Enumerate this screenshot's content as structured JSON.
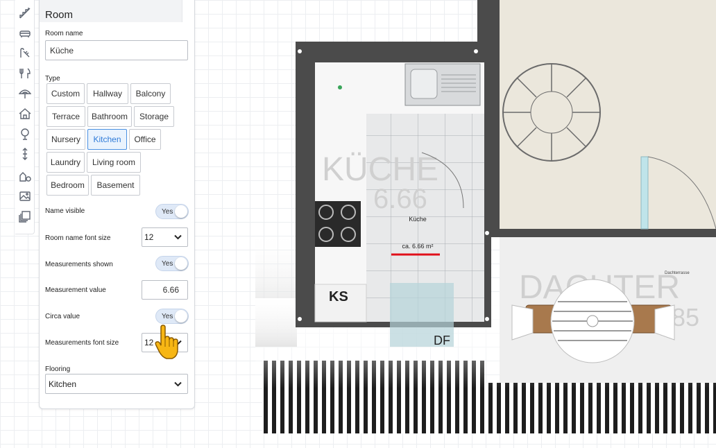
{
  "panel": {
    "title": "Room",
    "room_name_label": "Room name",
    "room_name_value": "Küche",
    "type_label": "Type",
    "types": [
      "Custom",
      "Hallway",
      "Balcony",
      "Terrace",
      "Bathroom",
      "Storage",
      "Nursery",
      "Kitchen",
      "Office",
      "Laundry",
      "Living room",
      "Bedroom",
      "Basement"
    ],
    "selected_type": "Kitchen",
    "name_visible_label": "Name visible",
    "name_visible_value": "Yes",
    "name_font_size_label": "Room name font size",
    "name_font_size_value": "12",
    "measurements_shown_label": "Measurements shown",
    "measurements_shown_value": "Yes",
    "measurement_value_label": "Measurement value",
    "measurement_value": "6.66",
    "circa_label": "Circa value",
    "circa_value": "Yes",
    "meas_font_size_label": "Measurements font size",
    "meas_font_size_value": "12",
    "flooring_label": "Flooring",
    "flooring_value": "Kitchen"
  },
  "toolbar": {
    "icons": [
      "stairs-icon",
      "sofa-icon",
      "bath-icon",
      "cutlery-icon",
      "umbrella-icon",
      "house-icon",
      "tree-icon",
      "height-icon",
      "shapes-icon",
      "image-icon",
      "layers-icon"
    ]
  },
  "plan": {
    "room_label": "Küche",
    "area_label": "ca. 6.66 m²",
    "ks_label": "KS",
    "df_label": "DF",
    "bg_kitchen_text": "KÜCHE",
    "bg_kitchen_area": "6.66",
    "bg_terrace_text": "DACHTER",
    "bg_terrace_num": "85",
    "terrace_label": "Dachterrasse"
  },
  "colors": {
    "accent": "#4a90e2",
    "wall": "#4b4b4b",
    "measure_underline": "#e0101a"
  }
}
